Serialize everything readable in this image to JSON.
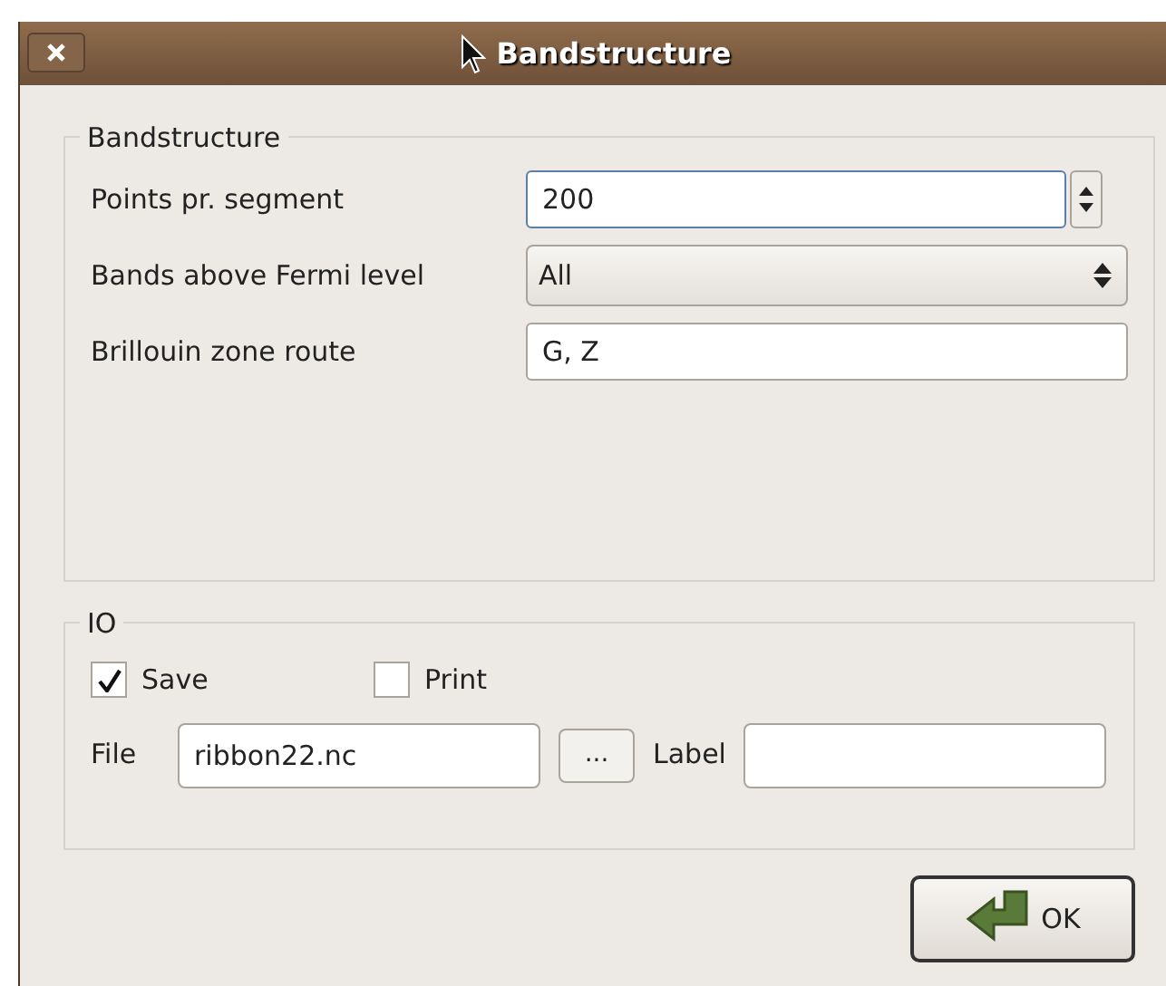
{
  "window": {
    "title": "Bandstructure"
  },
  "bandstructure": {
    "title": "Bandstructure",
    "fields": [
      {
        "kind": "spin",
        "label": "Points pr. segment",
        "value": "200",
        "focused": true
      },
      {
        "kind": "combo",
        "label": "Bands above Fermi level",
        "value": "All",
        "focused": false
      },
      {
        "kind": "text",
        "label": "Brillouin zone route",
        "value": "G, Z",
        "focused": false
      }
    ]
  },
  "io": {
    "title": "IO",
    "checkboxes": [
      {
        "label": "Save",
        "checked": true
      },
      {
        "label": "Print",
        "checked": false
      }
    ],
    "file_label": "File",
    "file_value": "ribbon22.nc",
    "browse": "...",
    "label_label": "Label"
  },
  "buttons": [
    {
      "label": "OK"
    }
  ]
}
